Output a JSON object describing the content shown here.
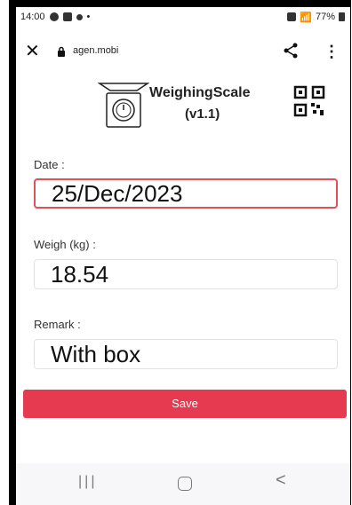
{
  "status": {
    "time": "14:00",
    "battery": "77%"
  },
  "browser": {
    "url": "agen.mobi"
  },
  "app": {
    "title": "WeighingScale",
    "version": "(v1.1)"
  },
  "form": {
    "date_label": "Date :",
    "date_value": "25/Dec/2023",
    "weigh_label": "Weigh (kg) :",
    "weigh_value": "18.54",
    "remark_label": "Remark :",
    "remark_value": "With box"
  },
  "actions": {
    "save_label": "Save"
  },
  "nav": {
    "recent_glyph": "|||",
    "back_glyph": "<"
  },
  "colors": {
    "accent": "#e53a4f",
    "focus_border": "#e0505c"
  }
}
